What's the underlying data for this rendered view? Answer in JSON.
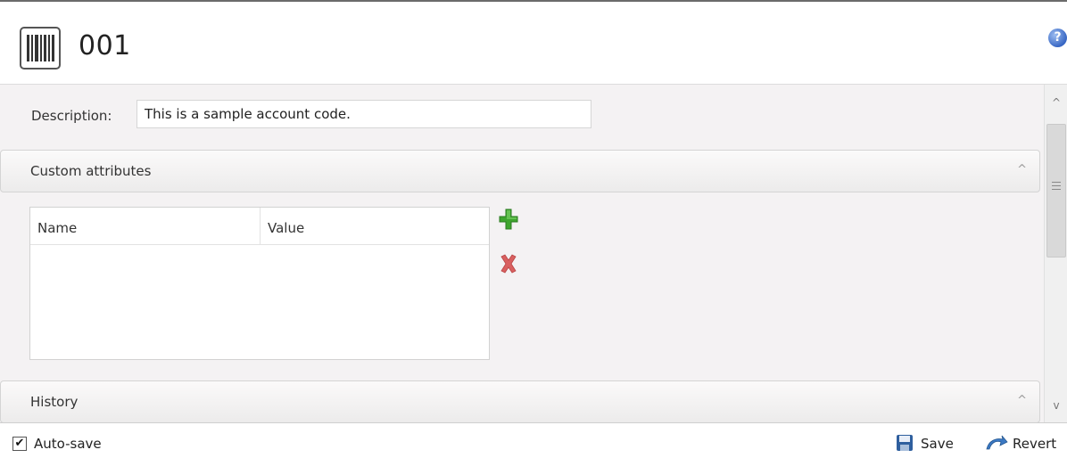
{
  "header": {
    "title": "001",
    "icon": "barcode-icon",
    "help_icon": "help-icon",
    "help_glyph": "?"
  },
  "form": {
    "description_label": "Description:",
    "description_value": "This is a sample account code."
  },
  "sections": {
    "custom_attributes": {
      "title": "Custom attributes",
      "chevron": "^",
      "table": {
        "columns": [
          "Name",
          "Value"
        ],
        "rows": []
      },
      "add_icon": "plus-icon",
      "remove_icon": "x-icon"
    },
    "history": {
      "title": "History",
      "chevron": "^"
    }
  },
  "scrollbar": {
    "up_glyph": "^",
    "down_glyph": "v"
  },
  "footer": {
    "autosave_label": "Auto-save",
    "autosave_checked": true,
    "autosave_glyph": "✔",
    "save_label": "Save",
    "revert_label": "Revert"
  },
  "colors": {
    "panel_bg": "#f4f2f3",
    "add_green": "#3fa52f",
    "remove_red": "#d96060",
    "help_blue": "#3867c4"
  }
}
